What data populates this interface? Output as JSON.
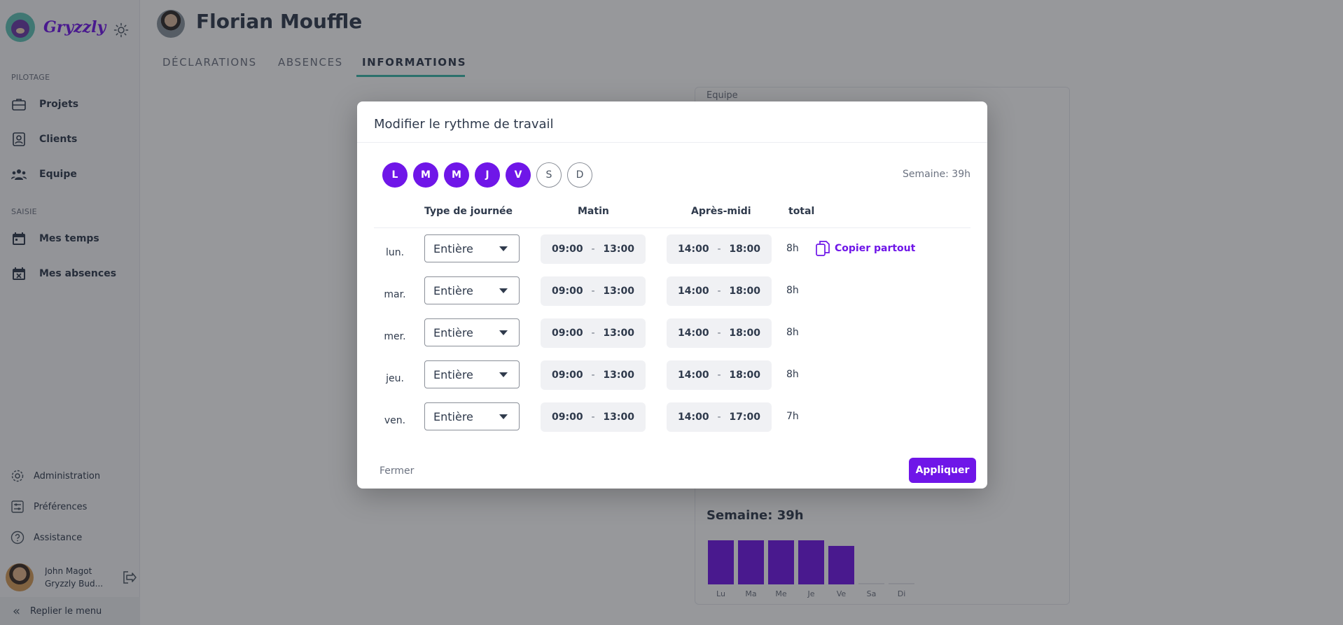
{
  "sidebar": {
    "logo": "Gryzzly",
    "sections": [
      {
        "title": "PILOTAGE",
        "items": [
          "Projets",
          "Clients",
          "Equipe"
        ]
      },
      {
        "title": "SAISIE",
        "items": [
          "Mes temps",
          "Mes absences"
        ]
      }
    ],
    "bottom_items": [
      "Administration",
      "Préférences",
      "Assistance"
    ],
    "user": {
      "name": "John Magot",
      "company": "Gryzzly Bud..."
    },
    "collapse_label": "Replier le menu"
  },
  "header": {
    "title": "Florian Mouffle",
    "tabs": [
      "DÉCLARATIONS",
      "ABSENCES",
      "INFORMATIONS"
    ],
    "active_tab": "INFORMATIONS"
  },
  "card": {
    "label": "Equipe",
    "week_total": "Semaine: 39h"
  },
  "chart_data": {
    "type": "bar",
    "categories": [
      "Lu",
      "Ma",
      "Me",
      "Je",
      "Ve",
      "Sa",
      "Di"
    ],
    "values": [
      8,
      8,
      8,
      8,
      7,
      0,
      0
    ],
    "ylim": [
      0,
      8
    ]
  },
  "modal": {
    "title": "Modifier le rythme de travail",
    "days": [
      {
        "letter": "L",
        "active": true
      },
      {
        "letter": "M",
        "active": true
      },
      {
        "letter": "M",
        "active": true
      },
      {
        "letter": "J",
        "active": true
      },
      {
        "letter": "V",
        "active": true
      },
      {
        "letter": "S",
        "active": false
      },
      {
        "letter": "D",
        "active": false
      }
    ],
    "week_total": "Semaine: 39h",
    "columns": {
      "type": "Type de journée",
      "morning": "Matin",
      "afternoon": "Après-midi",
      "total": "total"
    },
    "rows": [
      {
        "day": "lun.",
        "type": "Entière",
        "am_start": "09:00",
        "am_end": "13:00",
        "pm_start": "14:00",
        "pm_end": "18:00",
        "total": "8h"
      },
      {
        "day": "mar.",
        "type": "Entière",
        "am_start": "09:00",
        "am_end": "13:00",
        "pm_start": "14:00",
        "pm_end": "18:00",
        "total": "8h"
      },
      {
        "day": "mer.",
        "type": "Entière",
        "am_start": "09:00",
        "am_end": "13:00",
        "pm_start": "14:00",
        "pm_end": "18:00",
        "total": "8h"
      },
      {
        "day": "jeu.",
        "type": "Entière",
        "am_start": "09:00",
        "am_end": "13:00",
        "pm_start": "14:00",
        "pm_end": "18:00",
        "total": "8h"
      },
      {
        "day": "ven.",
        "type": "Entière",
        "am_start": "09:00",
        "am_end": "13:00",
        "pm_start": "14:00",
        "pm_end": "17:00",
        "total": "7h"
      }
    ],
    "time_separator": "-",
    "copy_label": "Copier partout",
    "close_label": "Fermer",
    "apply_label": "Appliquer"
  },
  "colors": {
    "accent": "#6f16e8",
    "tab_underline": "#39b7a8",
    "text": "#2f3a4c"
  }
}
